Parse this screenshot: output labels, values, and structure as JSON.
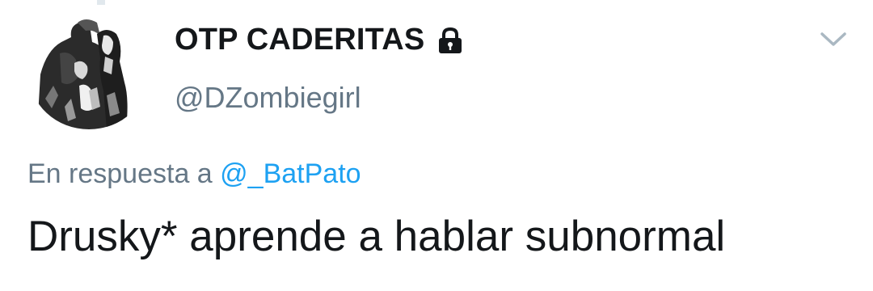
{
  "user": {
    "display_name": "OTP CADERITAS",
    "handle": "@DZombiegirl",
    "protected_icon": "lock-icon",
    "avatar_icon": "avatar-illustration"
  },
  "reply": {
    "prefix": "En respuesta a",
    "mention": "@_BatPato"
  },
  "tweet": {
    "text": "Drusky* aprende a hablar subnormal"
  },
  "menu": {
    "icon": "chevron-down-icon"
  },
  "colors": {
    "text_primary": "#14171a",
    "text_secondary": "#657786",
    "link": "#1da1f2",
    "caret": "#aab8c2"
  }
}
